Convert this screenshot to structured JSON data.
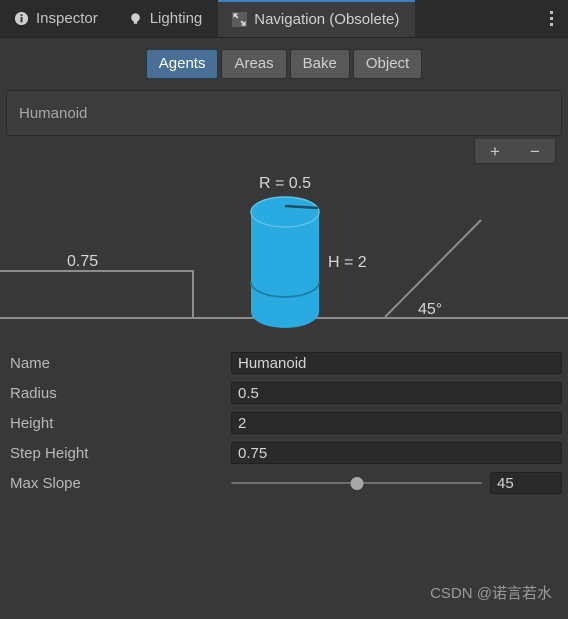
{
  "window": {
    "tabs": [
      {
        "label": "Inspector",
        "icon": "info-icon",
        "active": false
      },
      {
        "label": "Lighting",
        "icon": "lightbulb-icon",
        "active": false
      },
      {
        "label": "Navigation (Obsolete)",
        "icon": "navigation-icon",
        "active": true
      }
    ],
    "menu_icon": "kebab-menu-icon"
  },
  "mode_toolbar": {
    "buttons": [
      {
        "label": "Agents",
        "selected": true
      },
      {
        "label": "Areas",
        "selected": false
      },
      {
        "label": "Bake",
        "selected": false
      },
      {
        "label": "Object",
        "selected": false
      }
    ]
  },
  "agent_list": {
    "items": [
      {
        "label": "Humanoid",
        "selected": false
      }
    ],
    "add_label": "+",
    "remove_label": "−"
  },
  "diagram": {
    "radius_label": "R = 0.5",
    "height_label": "H = 2",
    "step_label": "0.75",
    "slope_label": "45°",
    "agent_color": "#29abe2",
    "line_color": "#8c8c8c"
  },
  "properties": [
    {
      "label": "Name",
      "value": "Humanoid",
      "type": "text"
    },
    {
      "label": "Radius",
      "value": "0.5",
      "type": "text"
    },
    {
      "label": "Height",
      "value": "2",
      "type": "text"
    },
    {
      "label": "Step Height",
      "value": "0.75",
      "type": "text"
    },
    {
      "label": "Max Slope",
      "value": "45",
      "type": "slider",
      "slider_percent": 50
    }
  ],
  "watermark": {
    "text": "CSDN @诺言若水"
  },
  "colors": {
    "window_bg": "#383838",
    "tabbar_bg": "#2b2b2b",
    "active_tab_bg": "#3c3c3c",
    "accent_blue": "#3b7fc4",
    "selected_button": "#4a6f96",
    "field_bg": "#2a2a2a"
  }
}
